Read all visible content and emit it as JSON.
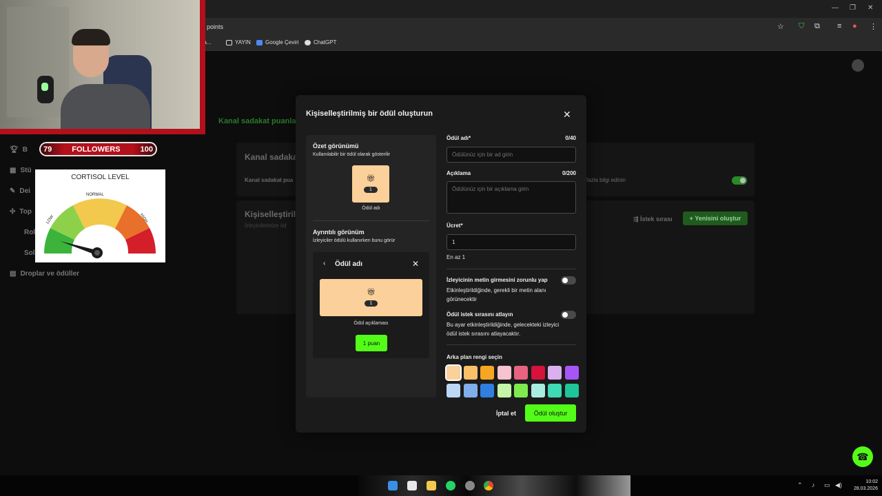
{
  "browser": {
    "url_fragment": "points",
    "bookmarks": [
      {
        "label": "Sa...",
        "icon": "bookmark-icon"
      },
      {
        "label": "YAYIN",
        "icon": "folder-icon"
      },
      {
        "label": "Google Çeviri",
        "icon": "translate-icon"
      },
      {
        "label": "ChatGPT",
        "icon": "chatgpt-icon"
      }
    ]
  },
  "background_page": {
    "breadcrumb_tab": "Kanal sadakat puanları",
    "section1_title": "Kanal sadakat",
    "section1_row": "Kanal sadakat pua",
    "section1_link": "fazla bilgi edinin",
    "section2_title": "Kişiselleştiril",
    "section2_sub": "İzleyicilerinize öd",
    "queue_label": "İstek sırası",
    "new_button": "Yenisini oluştur",
    "sidebar": [
      {
        "label": "B",
        "icon": "trophy-icon"
      },
      {
        "label": "Stü",
        "icon": "grid-icon"
      },
      {
        "label": "Dei",
        "icon": "wrench-icon"
      },
      {
        "label": "Top",
        "icon": "puzzle-icon"
      },
      {
        "label": "Rol",
        "icon": ""
      },
      {
        "label": "Sol",
        "icon": ""
      },
      {
        "label": "Droplar ve ödüller",
        "icon": "drops-icon"
      }
    ]
  },
  "overlay": {
    "followers_current": "79",
    "followers_label": "FOLLOWERS",
    "followers_goal": "100",
    "gauge_title": "CORTISOL LEVEL",
    "gauge_low": "LOW",
    "gauge_normal": "NORMAL",
    "gauge_high": "HIGH"
  },
  "modal": {
    "title": "Kişiselleştirilmiş bir ödül oluşturun",
    "preview": {
      "summary_title": "Özet görünümü",
      "summary_sub": "Kullanılabilir bir ödül olarak gösterilir",
      "tile_cost": "1",
      "tile_name": "Ödül adı",
      "detail_title": "Ayrıntılı görünüm",
      "detail_sub": "İzleyiciler ödülü kullanırken bunu görür",
      "card_title": "Ödül adı",
      "card_desc": "Ödül açıklaması",
      "card_price": "1 puan"
    },
    "form": {
      "name_label": "Ödül adı*",
      "name_count": "0/40",
      "name_placeholder": "Ödülünüz için bir ad girin",
      "desc_label": "Açıklama",
      "desc_count": "0/200",
      "desc_placeholder": "Ödülünüz için bir açıklama girin",
      "cost_label": "Ücret*",
      "cost_value": "1",
      "cost_hint": "En az 1",
      "text_required_label": "İzleyicinin metin girmesini zorunlu yap",
      "text_required_desc": "Etkinleştirildiğinde, gerekli bir metin alanı görünecektir",
      "skip_queue_label": "Ödül istek sırasını atlayın",
      "skip_queue_desc": "Bu ayar etkinleştirildiğinde, gelecekteki izleyici ödül istek sırasını atlayacaktır.",
      "color_label": "Arka plan rengi seçin",
      "colors_row1": [
        "#fcd09a",
        "#f9c06a",
        "#f5a623",
        "#f7c3d0",
        "#e8637f",
        "#d6123d",
        "#dbb0f0",
        "#a855f7"
      ],
      "colors_row2": [
        "#bcd6f5",
        "#7fb0ea",
        "#2f7ee0",
        "#c5f5a8",
        "#7eea4e",
        "#a8ede0",
        "#3fd9b5",
        "#1fc59a"
      ],
      "selected_color": "#fcd09a"
    },
    "cancel_label": "İptal et",
    "create_label": "Ödül oluştur"
  },
  "taskbar": {
    "time": "10:02",
    "date": "28.03.2026"
  }
}
